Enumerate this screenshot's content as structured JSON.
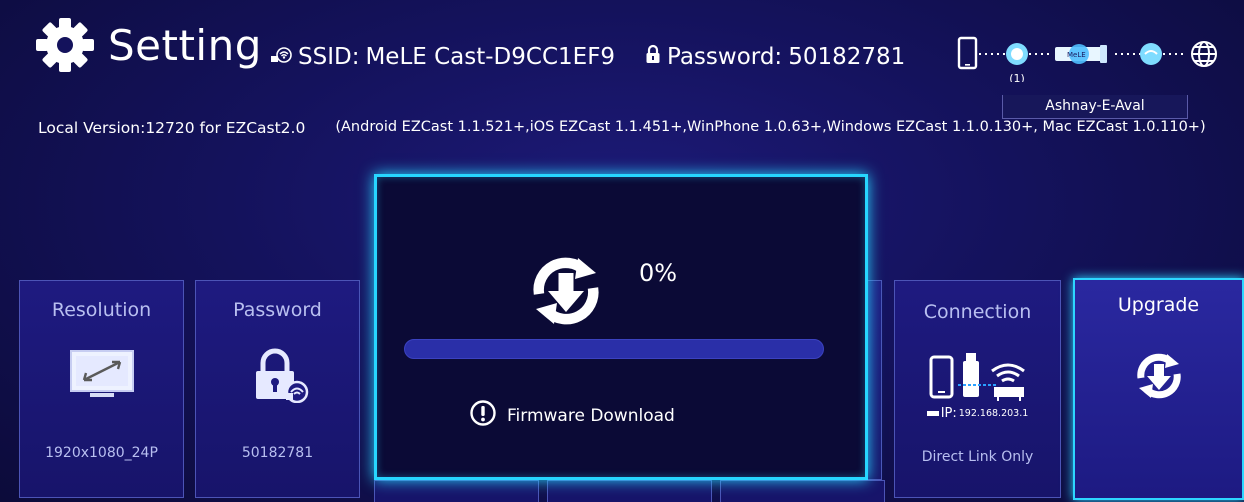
{
  "header": {
    "title": "Setting",
    "ssid_label": "SSID:",
    "ssid_value": "MeLE Cast-D9CC1EF9",
    "password_label": "Password:",
    "password_value": "50182781",
    "device_count": "(1)",
    "dongle_label": "MeLE",
    "connected_device": "Ashnay-E-Aval"
  },
  "version": {
    "local": "Local Version:12720 for EZCast2.0",
    "compat": "(Android EZCast 1.1.521+,iOS EZCast 1.1.451+,WinPhone 1.0.63+,Windows EZCast 1.1.0.130+, Mac EZCast 1.0.110+)"
  },
  "tiles": {
    "resolution": {
      "label": "Resolution",
      "value": "1920x1080_24P",
      "icon": "monitor-icon"
    },
    "password": {
      "label": "Password",
      "value": "50182781",
      "icon": "lock-wifi-icon"
    },
    "connection": {
      "label": "Connection",
      "ip": "192.168.203.1",
      "ip_prefix": "IP:",
      "value": "Direct Link Only",
      "icon": "phone-dongle-router-icon"
    },
    "upgrade": {
      "label": "Upgrade",
      "icon": "upgrade-icon"
    }
  },
  "dialog": {
    "percent": "0%",
    "progress": 0,
    "message": "Firmware Download",
    "icon": "upgrade-icon",
    "msg_icon": "info-icon"
  },
  "colors": {
    "accent": "#27d6ff",
    "background": "#14125c",
    "tile_border": "#4c54b6"
  }
}
